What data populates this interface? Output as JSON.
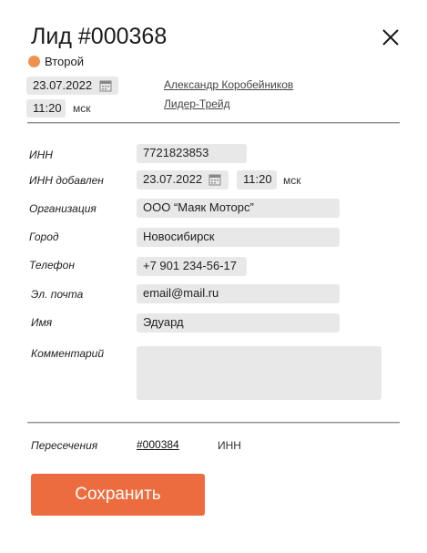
{
  "header": {
    "title": "Лид #000368",
    "status_label": "Второй",
    "status_color": "#f0924e",
    "close_icon": "close-icon"
  },
  "meta": {
    "date": "23.07.2022",
    "time": "11:20",
    "tz": "мск",
    "person": "Александр Коробейников",
    "company": "Лидер-Трейд"
  },
  "form": {
    "inn_label": "ИНН",
    "inn_value": "7721823853",
    "inn_added_label": "ИНН добавлен",
    "inn_added_date": "23.07.2022",
    "inn_added_time": "11:20",
    "inn_added_tz": "мск",
    "org_label": "Организация",
    "org_value": "ООО “Маяк Моторс”",
    "city_label": "Город",
    "city_value": "Новосибирск",
    "phone_label": "Телефон",
    "phone_value": "+7 901 234-56-17",
    "email_label": "Эл. почта",
    "email_value": "email@mail.ru",
    "name_label": "Имя",
    "name_value": "Эдуард",
    "comment_label": "Комментарий",
    "comment_value": ""
  },
  "intersections": {
    "label": "Пересечения",
    "link": "#000384",
    "type": "ИНН"
  },
  "actions": {
    "save_label": "Сохранить",
    "save_color": "#ec6c3f"
  }
}
